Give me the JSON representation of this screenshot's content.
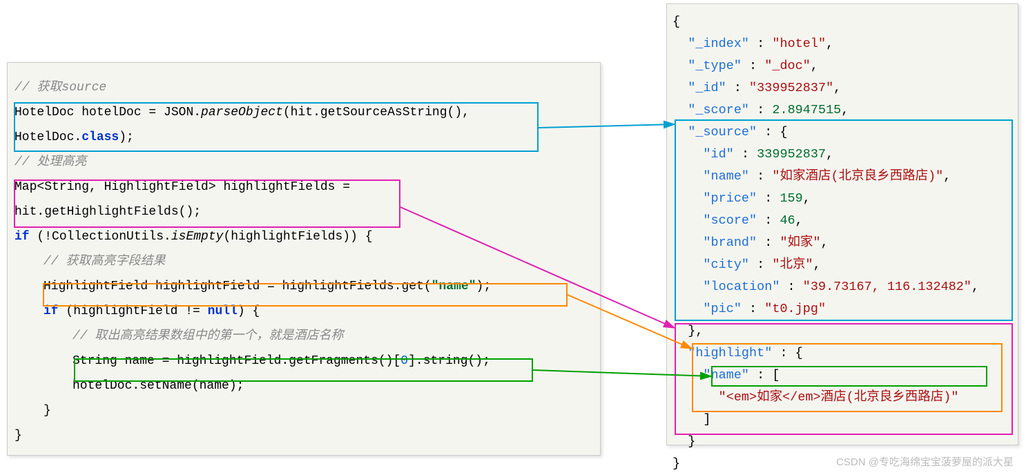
{
  "left": {
    "c1": "// 获取source",
    "l1a": "HotelDoc hotelDoc = JSON.",
    "l1b": "parseObject",
    "l1c": "(hit.getSourceAsString(),",
    "l2a": "HotelDoc.",
    "l2b": "class",
    "l2c": ");",
    "c2": "// 处理高亮",
    "l3": "Map<String, HighlightField> highlightFields =",
    "l4": "hit.getHighlightFields();",
    "l5a": "if",
    "l5b": " (!CollectionUtils.",
    "l5c": "isEmpty",
    "l5d": "(highlightFields)) {",
    "c3": "// 获取高亮字段结果",
    "l6a": "HighlightField highlightField = highlightFields.get(",
    "l6b": "\"name\"",
    "l6c": ");",
    "l7a": "if",
    "l7b": " (highlightField != ",
    "l7c": "null",
    "l7d": ") {",
    "c4": "// 取出高亮结果数组中的第一个，就是酒店名称",
    "l8a": "String name = highlightField.getFragments()[",
    "l8b": "0",
    "l8c": "].string();",
    "l9": "hotelDoc.setName(name);",
    "l10": "}",
    "l11": "}"
  },
  "right": {
    "r0": "{",
    "r1k": "\"_index\"",
    "r1c": " : ",
    "r1v": "\"hotel\"",
    "r1e": ",",
    "r2k": "\"_type\"",
    "r2c": " : ",
    "r2v": "\"_doc\"",
    "r2e": ",",
    "r3k": "\"_id\"",
    "r3c": " : ",
    "r3v": "\"339952837\"",
    "r3e": ",",
    "r4k": "\"_score\"",
    "r4c": " : ",
    "r4v": "2.8947515",
    "r4e": ",",
    "r5k": "\"_source\"",
    "r5c": " : {",
    "r6k": "\"id\"",
    "r6c": " : ",
    "r6v": "339952837",
    "r6e": ",",
    "r7k": "\"name\"",
    "r7c": " : ",
    "r7v": "\"如家酒店(北京良乡西路店)\"",
    "r7e": ",",
    "r8k": "\"price\"",
    "r8c": " : ",
    "r8v": "159",
    "r8e": ",",
    "r9k": "\"score\"",
    "r9c": " : ",
    "r9v": "46",
    "r9e": ",",
    "r10k": "\"brand\"",
    "r10c": " : ",
    "r10v": "\"如家\"",
    "r10e": ",",
    "r11k": "\"city\"",
    "r11c": " : ",
    "r11v": "\"北京\"",
    "r11e": ",",
    "r12k": "\"location\"",
    "r12c": " : ",
    "r12v": "\"39.73167, 116.132482\"",
    "r12e": ",",
    "r13k": "\"pic\"",
    "r13c": " : ",
    "r13v": "\"t0.jpg\"",
    "r14": "},",
    "r15k": "\"highlight\"",
    "r15c": " : {",
    "r16k": "\"name\"",
    "r16c": " : [",
    "r17v": "\"<em>如家</em>酒店(北京良乡西路店)\"",
    "r18": "]",
    "r19": "}",
    "r20": "}"
  },
  "watermark": "CSDN @专吃海绵宝宝菠萝屋的派大星"
}
